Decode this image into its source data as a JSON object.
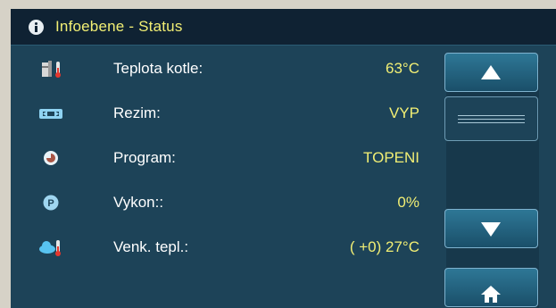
{
  "header": {
    "title": "Infoebene - Status",
    "icon": "info-icon"
  },
  "rows": [
    {
      "icon": "boiler-thermometer-icon",
      "label": "Teplota kotle:",
      "value": "63°C"
    },
    {
      "icon": "mode-switch-icon",
      "label": "Rezim:",
      "value": "VYP"
    },
    {
      "icon": "program-icon",
      "label": "Program:",
      "value": "TOPENI"
    },
    {
      "icon": "power-p-icon",
      "label": "Vykon::",
      "value": "0%"
    },
    {
      "icon": "outdoor-thermometer-icon",
      "label": "Venk. tepl.:",
      "value": "( +0) 27°C"
    }
  ],
  "scroll": {
    "up": "scroll-up-icon",
    "down": "scroll-down-icon",
    "home": "home-icon"
  },
  "colors": {
    "background": "#1d4358",
    "titlebar": "#0f2233",
    "value": "#f2ef74",
    "label": "#ffffff",
    "button": "#2e7796"
  }
}
